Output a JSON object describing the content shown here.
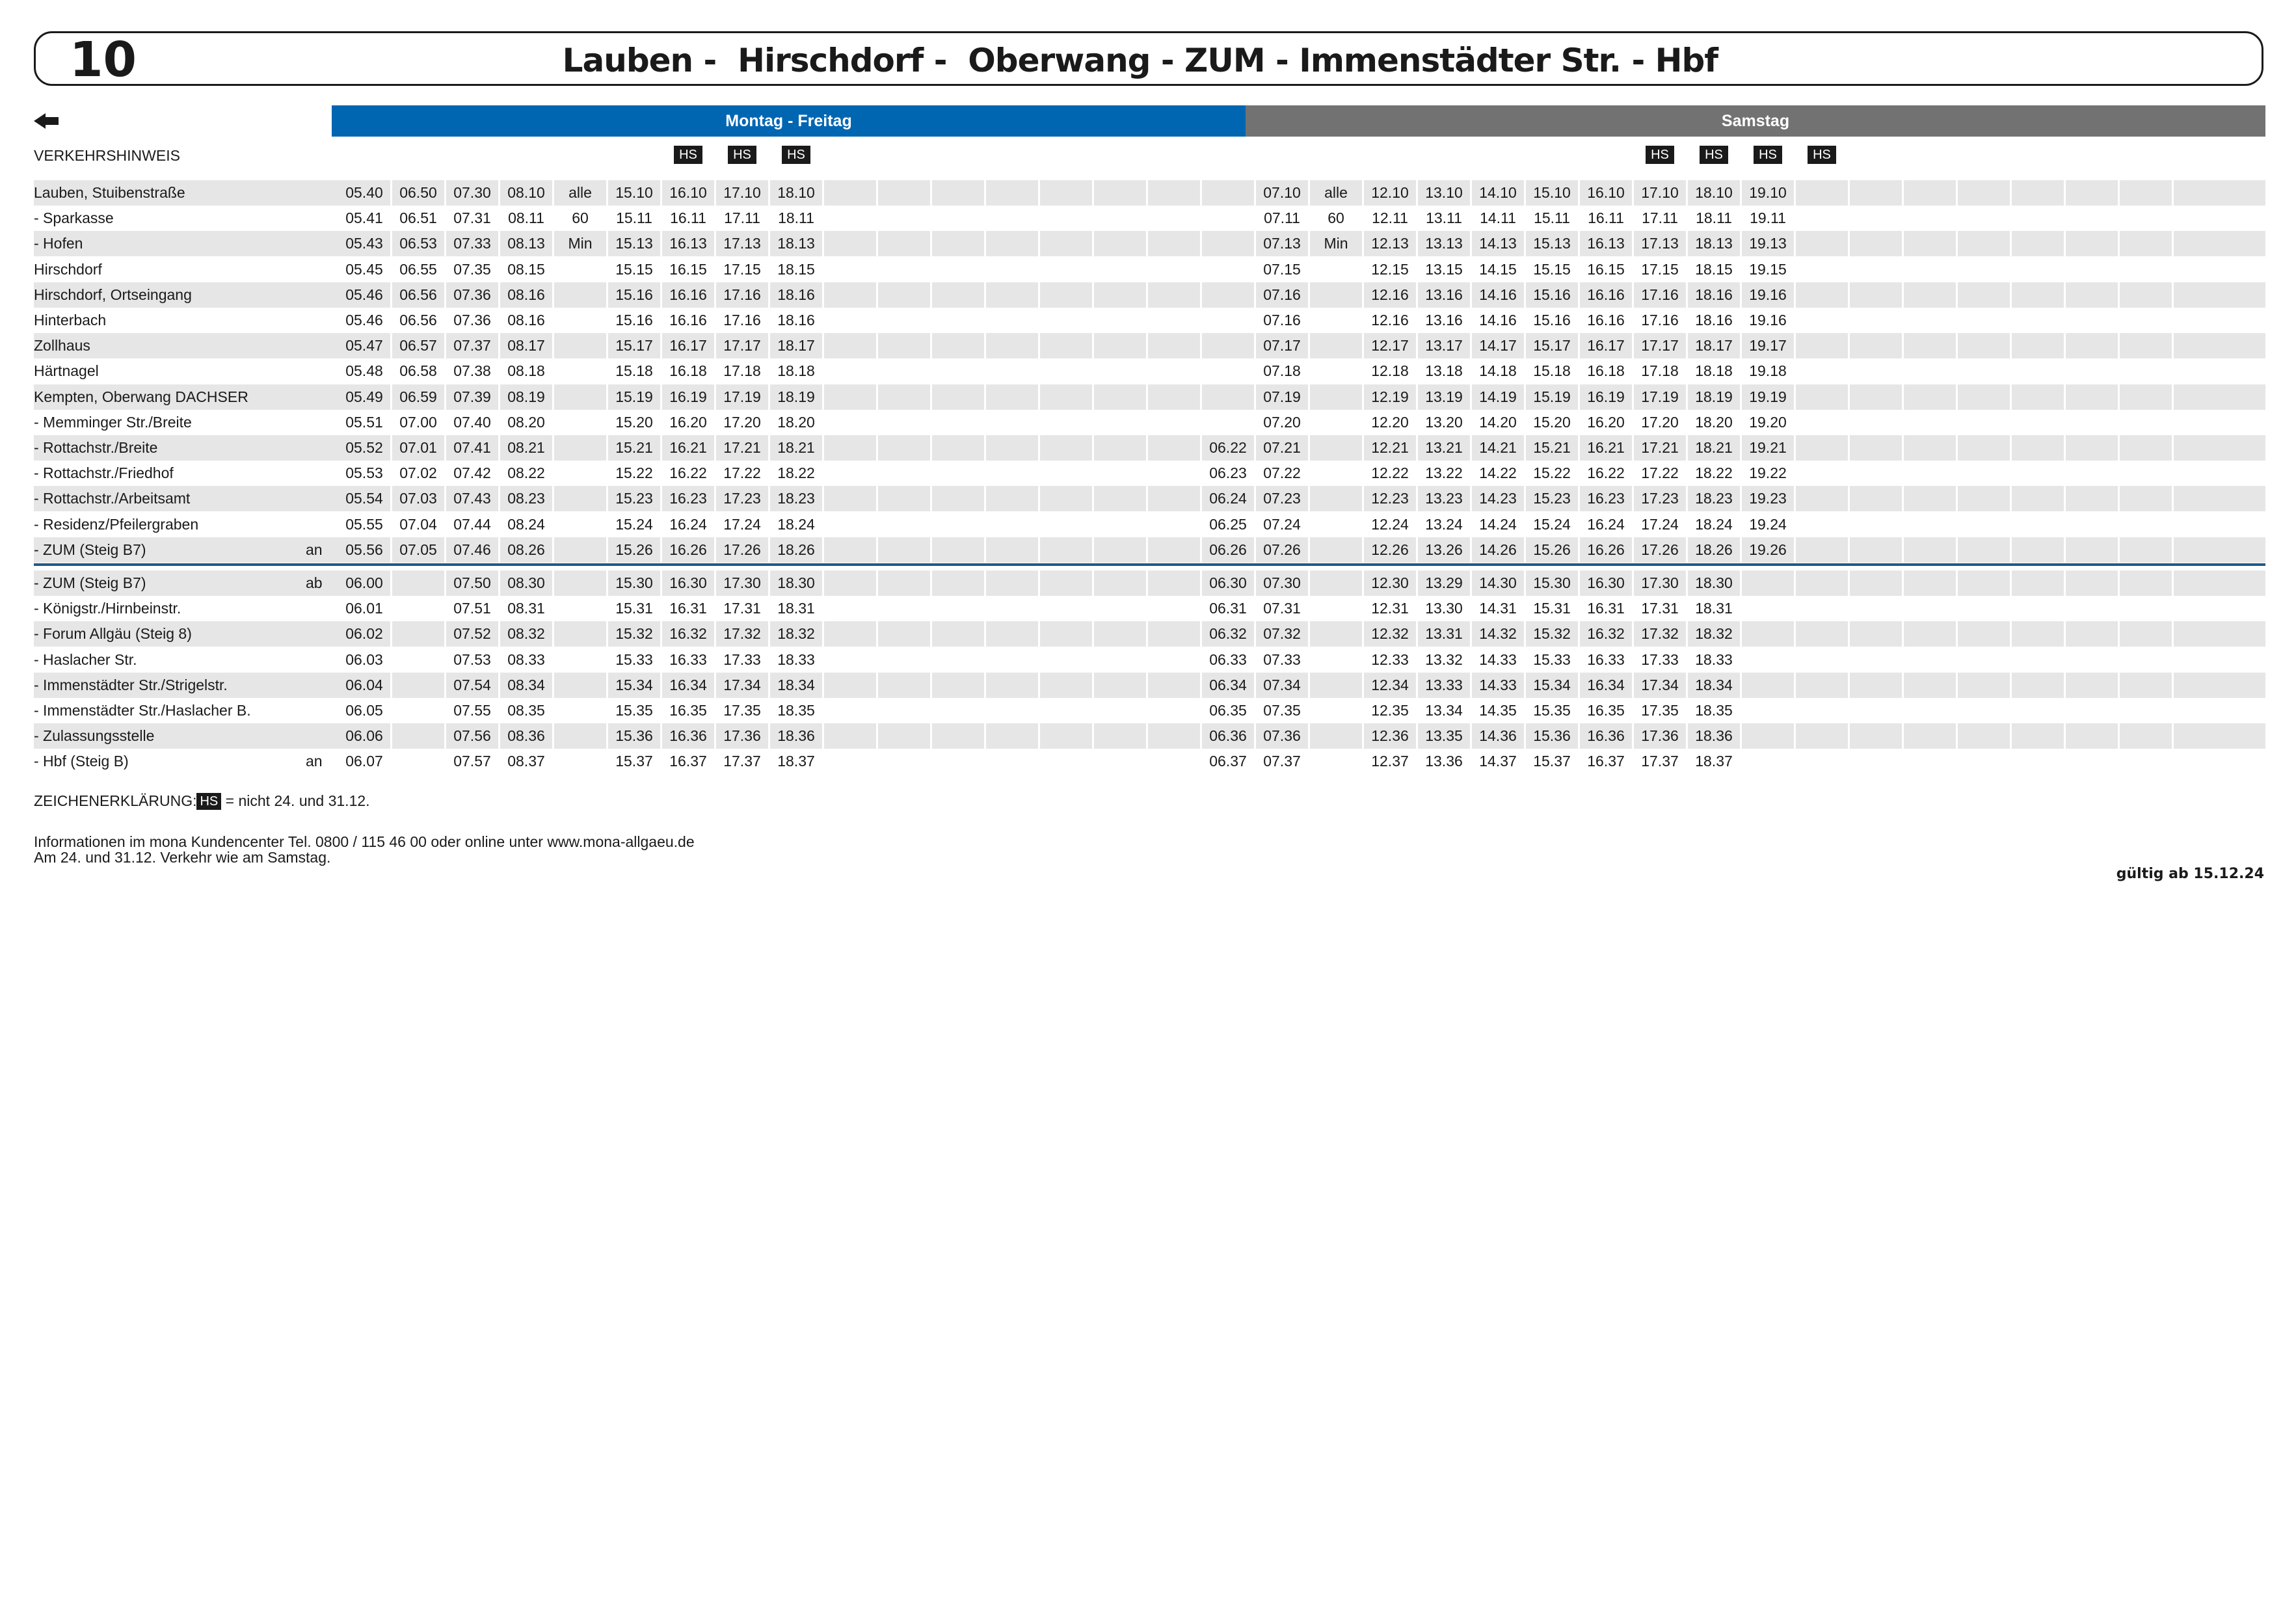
{
  "header": {
    "line_number": "10",
    "route_title": "Lauben -  Hirschdorf -  Oberwang - ZUM - Immenstädter Str. - Hbf"
  },
  "icons": {
    "back": "left-arrow-icon"
  },
  "colors": {
    "weekday_band": "#0066b2",
    "saturday_band": "#727272",
    "row_shade": "#e6e6e6",
    "divider": "#1e5a8c"
  },
  "day_bands": {
    "weekdays": "Montag - Freitag",
    "saturday": "Samstag"
  },
  "notice_label": "VERKEHRSHINWEIS",
  "hs_badge_text": "HS",
  "hs_columns": [
    6,
    7,
    8,
    24,
    25,
    26,
    27
  ],
  "timetable": {
    "column_count": 34,
    "outbound": [
      {
        "stop": "Lauben, Stuibenstraße",
        "flag": "",
        "times": [
          "05.40",
          "06.50",
          "07.30",
          "08.10",
          "alle",
          "15.10",
          "16.10",
          "17.10",
          "18.10",
          "",
          "",
          "",
          "",
          "",
          "",
          "",
          "",
          "07.10",
          "alle",
          "12.10",
          "13.10",
          "14.10",
          "15.10",
          "16.10",
          "17.10",
          "18.10",
          "19.10",
          "",
          "",
          "",
          "",
          "",
          "",
          ""
        ]
      },
      {
        "stop": "- Sparkasse",
        "flag": "",
        "times": [
          "05.41",
          "06.51",
          "07.31",
          "08.11",
          "60",
          "15.11",
          "16.11",
          "17.11",
          "18.11",
          "",
          "",
          "",
          "",
          "",
          "",
          "",
          "",
          "07.11",
          "60",
          "12.11",
          "13.11",
          "14.11",
          "15.11",
          "16.11",
          "17.11",
          "18.11",
          "19.11",
          "",
          "",
          "",
          "",
          "",
          "",
          ""
        ]
      },
      {
        "stop": "- Hofen",
        "flag": "",
        "times": [
          "05.43",
          "06.53",
          "07.33",
          "08.13",
          "Min",
          "15.13",
          "16.13",
          "17.13",
          "18.13",
          "",
          "",
          "",
          "",
          "",
          "",
          "",
          "",
          "07.13",
          "Min",
          "12.13",
          "13.13",
          "14.13",
          "15.13",
          "16.13",
          "17.13",
          "18.13",
          "19.13",
          "",
          "",
          "",
          "",
          "",
          "",
          ""
        ]
      },
      {
        "stop": "Hirschdorf",
        "flag": "",
        "times": [
          "05.45",
          "06.55",
          "07.35",
          "08.15",
          "",
          "15.15",
          "16.15",
          "17.15",
          "18.15",
          "",
          "",
          "",
          "",
          "",
          "",
          "",
          "",
          "07.15",
          "",
          "12.15",
          "13.15",
          "14.15",
          "15.15",
          "16.15",
          "17.15",
          "18.15",
          "19.15",
          "",
          "",
          "",
          "",
          "",
          "",
          ""
        ]
      },
      {
        "stop": "Hirschdorf, Ortseingang",
        "flag": "",
        "times": [
          "05.46",
          "06.56",
          "07.36",
          "08.16",
          "",
          "15.16",
          "16.16",
          "17.16",
          "18.16",
          "",
          "",
          "",
          "",
          "",
          "",
          "",
          "",
          "07.16",
          "",
          "12.16",
          "13.16",
          "14.16",
          "15.16",
          "16.16",
          "17.16",
          "18.16",
          "19.16",
          "",
          "",
          "",
          "",
          "",
          "",
          ""
        ]
      },
      {
        "stop": "Hinterbach",
        "flag": "",
        "times": [
          "05.46",
          "06.56",
          "07.36",
          "08.16",
          "",
          "15.16",
          "16.16",
          "17.16",
          "18.16",
          "",
          "",
          "",
          "",
          "",
          "",
          "",
          "",
          "07.16",
          "",
          "12.16",
          "13.16",
          "14.16",
          "15.16",
          "16.16",
          "17.16",
          "18.16",
          "19.16",
          "",
          "",
          "",
          "",
          "",
          "",
          ""
        ]
      },
      {
        "stop": "Zollhaus",
        "flag": "",
        "times": [
          "05.47",
          "06.57",
          "07.37",
          "08.17",
          "",
          "15.17",
          "16.17",
          "17.17",
          "18.17",
          "",
          "",
          "",
          "",
          "",
          "",
          "",
          "",
          "07.17",
          "",
          "12.17",
          "13.17",
          "14.17",
          "15.17",
          "16.17",
          "17.17",
          "18.17",
          "19.17",
          "",
          "",
          "",
          "",
          "",
          "",
          ""
        ]
      },
      {
        "stop": "Härtnagel",
        "flag": "",
        "times": [
          "05.48",
          "06.58",
          "07.38",
          "08.18",
          "",
          "15.18",
          "16.18",
          "17.18",
          "18.18",
          "",
          "",
          "",
          "",
          "",
          "",
          "",
          "",
          "07.18",
          "",
          "12.18",
          "13.18",
          "14.18",
          "15.18",
          "16.18",
          "17.18",
          "18.18",
          "19.18",
          "",
          "",
          "",
          "",
          "",
          "",
          ""
        ]
      },
      {
        "stop": "Kempten, Oberwang DACHSER",
        "flag": "",
        "times": [
          "05.49",
          "06.59",
          "07.39",
          "08.19",
          "",
          "15.19",
          "16.19",
          "17.19",
          "18.19",
          "",
          "",
          "",
          "",
          "",
          "",
          "",
          "",
          "07.19",
          "",
          "12.19",
          "13.19",
          "14.19",
          "15.19",
          "16.19",
          "17.19",
          "18.19",
          "19.19",
          "",
          "",
          "",
          "",
          "",
          "",
          ""
        ]
      },
      {
        "stop": "- Memminger Str./Breite",
        "flag": "",
        "times": [
          "05.51",
          "07.00",
          "07.40",
          "08.20",
          "",
          "15.20",
          "16.20",
          "17.20",
          "18.20",
          "",
          "",
          "",
          "",
          "",
          "",
          "",
          "",
          "07.20",
          "",
          "12.20",
          "13.20",
          "14.20",
          "15.20",
          "16.20",
          "17.20",
          "18.20",
          "19.20",
          "",
          "",
          "",
          "",
          "",
          "",
          ""
        ]
      },
      {
        "stop": "- Rottachstr./Breite",
        "flag": "",
        "times": [
          "05.52",
          "07.01",
          "07.41",
          "08.21",
          "",
          "15.21",
          "16.21",
          "17.21",
          "18.21",
          "",
          "",
          "",
          "",
          "",
          "",
          "",
          "06.22",
          "07.21",
          "",
          "12.21",
          "13.21",
          "14.21",
          "15.21",
          "16.21",
          "17.21",
          "18.21",
          "19.21",
          "",
          "",
          "",
          "",
          "",
          "",
          ""
        ]
      },
      {
        "stop": "- Rottachstr./Friedhof",
        "flag": "",
        "times": [
          "05.53",
          "07.02",
          "07.42",
          "08.22",
          "",
          "15.22",
          "16.22",
          "17.22",
          "18.22",
          "",
          "",
          "",
          "",
          "",
          "",
          "",
          "06.23",
          "07.22",
          "",
          "12.22",
          "13.22",
          "14.22",
          "15.22",
          "16.22",
          "17.22",
          "18.22",
          "19.22",
          "",
          "",
          "",
          "",
          "",
          "",
          ""
        ]
      },
      {
        "stop": "- Rottachstr./Arbeitsamt",
        "flag": "",
        "times": [
          "05.54",
          "07.03",
          "07.43",
          "08.23",
          "",
          "15.23",
          "16.23",
          "17.23",
          "18.23",
          "",
          "",
          "",
          "",
          "",
          "",
          "",
          "06.24",
          "07.23",
          "",
          "12.23",
          "13.23",
          "14.23",
          "15.23",
          "16.23",
          "17.23",
          "18.23",
          "19.23",
          "",
          "",
          "",
          "",
          "",
          "",
          ""
        ]
      },
      {
        "stop": "- Residenz/Pfeilergraben",
        "flag": "",
        "times": [
          "05.55",
          "07.04",
          "07.44",
          "08.24",
          "",
          "15.24",
          "16.24",
          "17.24",
          "18.24",
          "",
          "",
          "",
          "",
          "",
          "",
          "",
          "06.25",
          "07.24",
          "",
          "12.24",
          "13.24",
          "14.24",
          "15.24",
          "16.24",
          "17.24",
          "18.24",
          "19.24",
          "",
          "",
          "",
          "",
          "",
          "",
          ""
        ]
      },
      {
        "stop": "- ZUM (Steig B7)",
        "flag": "an",
        "times": [
          "05.56",
          "07.05",
          "07.46",
          "08.26",
          "",
          "15.26",
          "16.26",
          "17.26",
          "18.26",
          "",
          "",
          "",
          "",
          "",
          "",
          "",
          "06.26",
          "07.26",
          "",
          "12.26",
          "13.26",
          "14.26",
          "15.26",
          "16.26",
          "17.26",
          "18.26",
          "19.26",
          "",
          "",
          "",
          "",
          "",
          "",
          ""
        ]
      }
    ],
    "continuation": [
      {
        "stop": "- ZUM (Steig B7)",
        "flag": "ab",
        "times": [
          "06.00",
          "",
          "07.50",
          "08.30",
          "",
          "15.30",
          "16.30",
          "17.30",
          "18.30",
          "",
          "",
          "",
          "",
          "",
          "",
          "",
          "06.30",
          "07.30",
          "",
          "12.30",
          "13.29",
          "14.30",
          "15.30",
          "16.30",
          "17.30",
          "18.30",
          "",
          "",
          "",
          "",
          "",
          "",
          "",
          ""
        ]
      },
      {
        "stop": "- Königstr./Hirnbeinstr.",
        "flag": "",
        "times": [
          "06.01",
          "",
          "07.51",
          "08.31",
          "",
          "15.31",
          "16.31",
          "17.31",
          "18.31",
          "",
          "",
          "",
          "",
          "",
          "",
          "",
          "06.31",
          "07.31",
          "",
          "12.31",
          "13.30",
          "14.31",
          "15.31",
          "16.31",
          "17.31",
          "18.31",
          "",
          "",
          "",
          "",
          "",
          "",
          "",
          ""
        ]
      },
      {
        "stop": "- Forum Allgäu (Steig 8)",
        "flag": "",
        "times": [
          "06.02",
          "",
          "07.52",
          "08.32",
          "",
          "15.32",
          "16.32",
          "17.32",
          "18.32",
          "",
          "",
          "",
          "",
          "",
          "",
          "",
          "06.32",
          "07.32",
          "",
          "12.32",
          "13.31",
          "14.32",
          "15.32",
          "16.32",
          "17.32",
          "18.32",
          "",
          "",
          "",
          "",
          "",
          "",
          "",
          ""
        ]
      },
      {
        "stop": "- Haslacher Str.",
        "flag": "",
        "times": [
          "06.03",
          "",
          "07.53",
          "08.33",
          "",
          "15.33",
          "16.33",
          "17.33",
          "18.33",
          "",
          "",
          "",
          "",
          "",
          "",
          "",
          "06.33",
          "07.33",
          "",
          "12.33",
          "13.32",
          "14.33",
          "15.33",
          "16.33",
          "17.33",
          "18.33",
          "",
          "",
          "",
          "",
          "",
          "",
          "",
          ""
        ]
      },
      {
        "stop": "- Immenstädter Str./Strigelstr.",
        "flag": "",
        "times": [
          "06.04",
          "",
          "07.54",
          "08.34",
          "",
          "15.34",
          "16.34",
          "17.34",
          "18.34",
          "",
          "",
          "",
          "",
          "",
          "",
          "",
          "06.34",
          "07.34",
          "",
          "12.34",
          "13.33",
          "14.33",
          "15.34",
          "16.34",
          "17.34",
          "18.34",
          "",
          "",
          "",
          "",
          "",
          "",
          "",
          ""
        ]
      },
      {
        "stop": "- Immenstädter Str./Haslacher B.",
        "flag": "",
        "times": [
          "06.05",
          "",
          "07.55",
          "08.35",
          "",
          "15.35",
          "16.35",
          "17.35",
          "18.35",
          "",
          "",
          "",
          "",
          "",
          "",
          "",
          "06.35",
          "07.35",
          "",
          "12.35",
          "13.34",
          "14.35",
          "15.35",
          "16.35",
          "17.35",
          "18.35",
          "",
          "",
          "",
          "",
          "",
          "",
          "",
          ""
        ]
      },
      {
        "stop": "- Zulassungsstelle",
        "flag": "",
        "times": [
          "06.06",
          "",
          "07.56",
          "08.36",
          "",
          "15.36",
          "16.36",
          "17.36",
          "18.36",
          "",
          "",
          "",
          "",
          "",
          "",
          "",
          "06.36",
          "07.36",
          "",
          "12.36",
          "13.35",
          "14.36",
          "15.36",
          "16.36",
          "17.36",
          "18.36",
          "",
          "",
          "",
          "",
          "",
          "",
          "",
          ""
        ]
      },
      {
        "stop": "- Hbf (Steig B)",
        "flag": "an",
        "times": [
          "06.07",
          "",
          "07.57",
          "08.37",
          "",
          "15.37",
          "16.37",
          "17.37",
          "18.37",
          "",
          "",
          "",
          "",
          "",
          "",
          "",
          "06.37",
          "07.37",
          "",
          "12.37",
          "13.36",
          "14.37",
          "15.37",
          "16.37",
          "17.37",
          "18.37",
          "",
          "",
          "",
          "",
          "",
          "",
          "",
          ""
        ]
      }
    ]
  },
  "legend": {
    "label": "ZEICHENERKLÄRUNG:",
    "badge": "HS",
    "text": " = nicht 24. und 31.12."
  },
  "info": {
    "line1": "Informationen im mona Kundencenter Tel. 0800 / 115 46 00 oder online unter www.mona-allgaeu.de",
    "line2": "Am 24. und 31.12. Verkehr wie am Samstag."
  },
  "validity": "gültig ab 15.12.24"
}
